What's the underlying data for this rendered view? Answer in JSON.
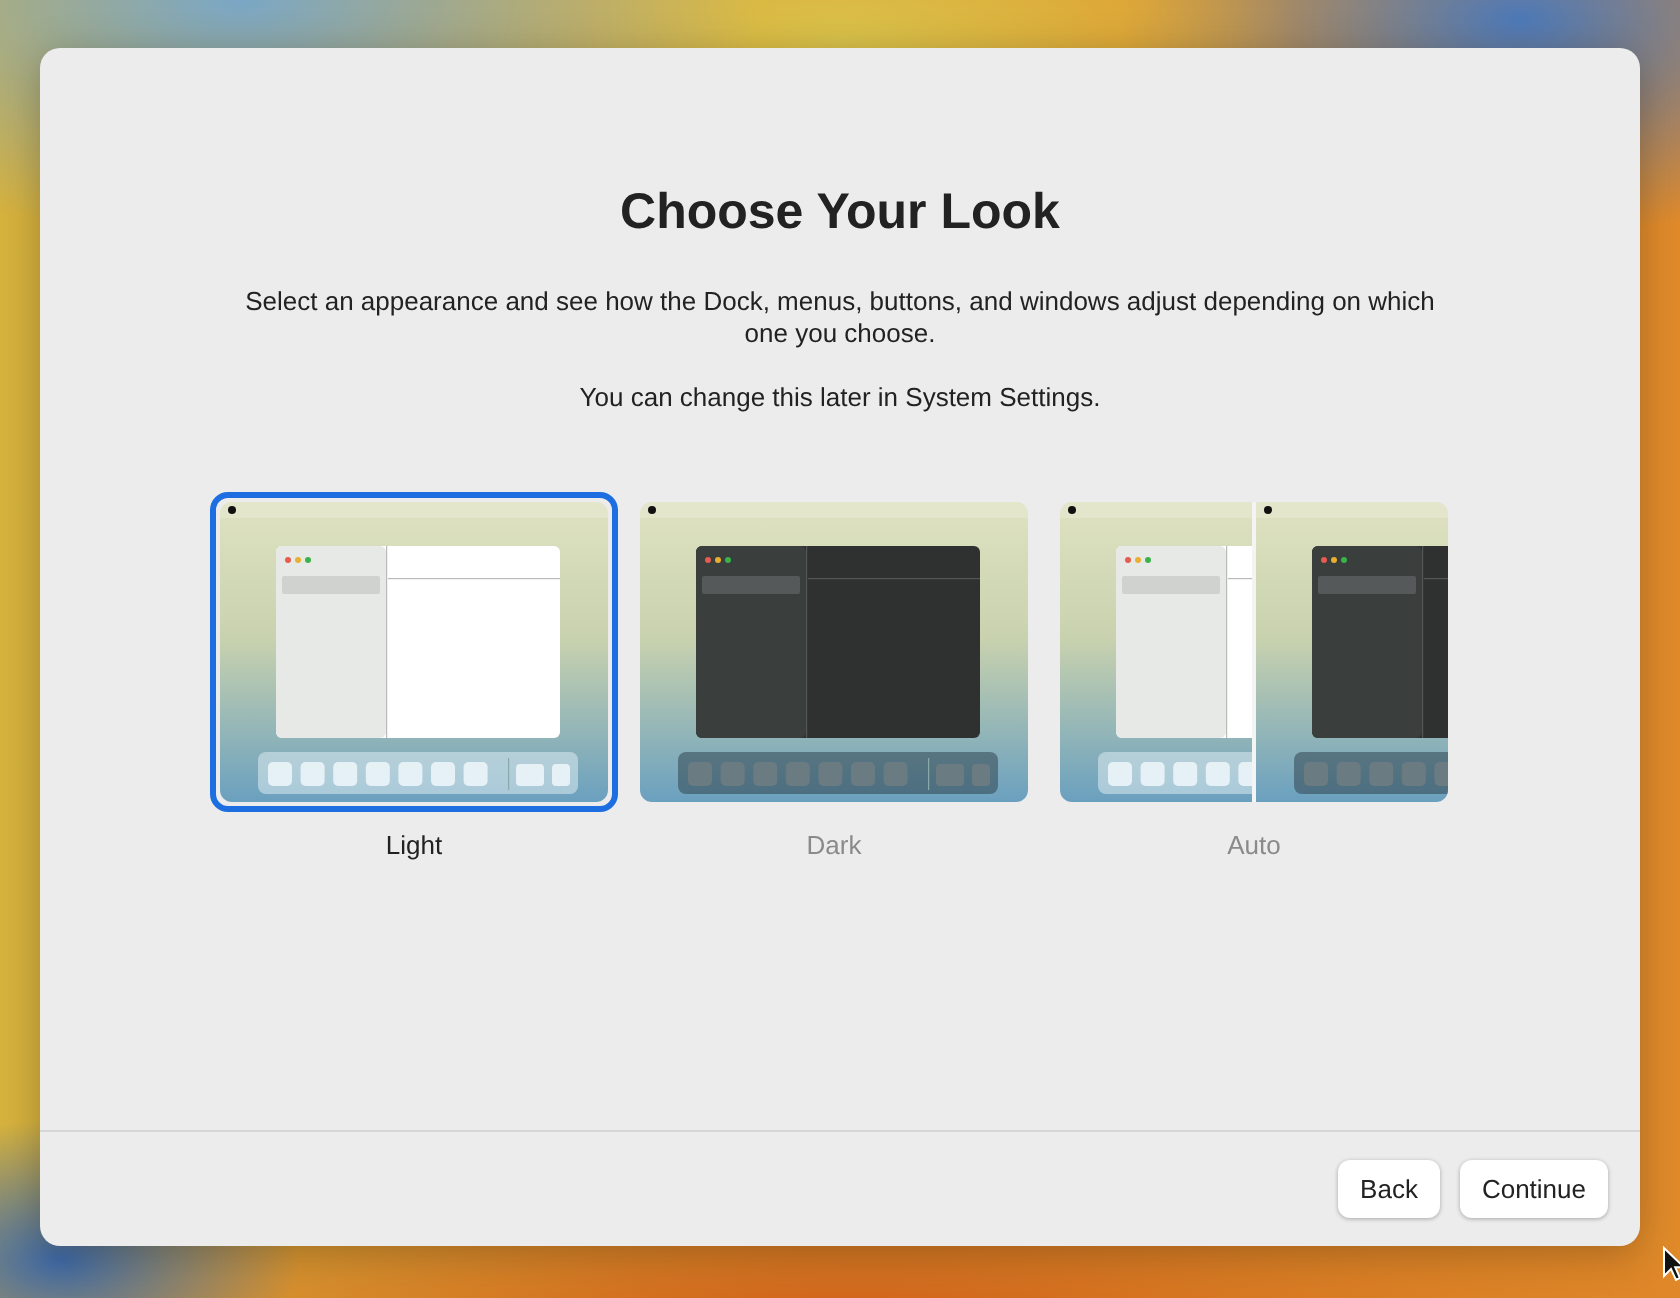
{
  "title": "Choose Your Look",
  "description": "Select an appearance and see how the Dock, menus, buttons, and windows adjust depending on which one you choose.",
  "note": "You can change this later in System Settings.",
  "options": [
    {
      "kind": "light",
      "label": "Light",
      "selected": true
    },
    {
      "kind": "dark",
      "label": "Dark",
      "selected": false
    },
    {
      "kind": "auto",
      "label": "Auto",
      "selected": false
    }
  ],
  "buttons": [
    "Back",
    "Continue"
  ]
}
